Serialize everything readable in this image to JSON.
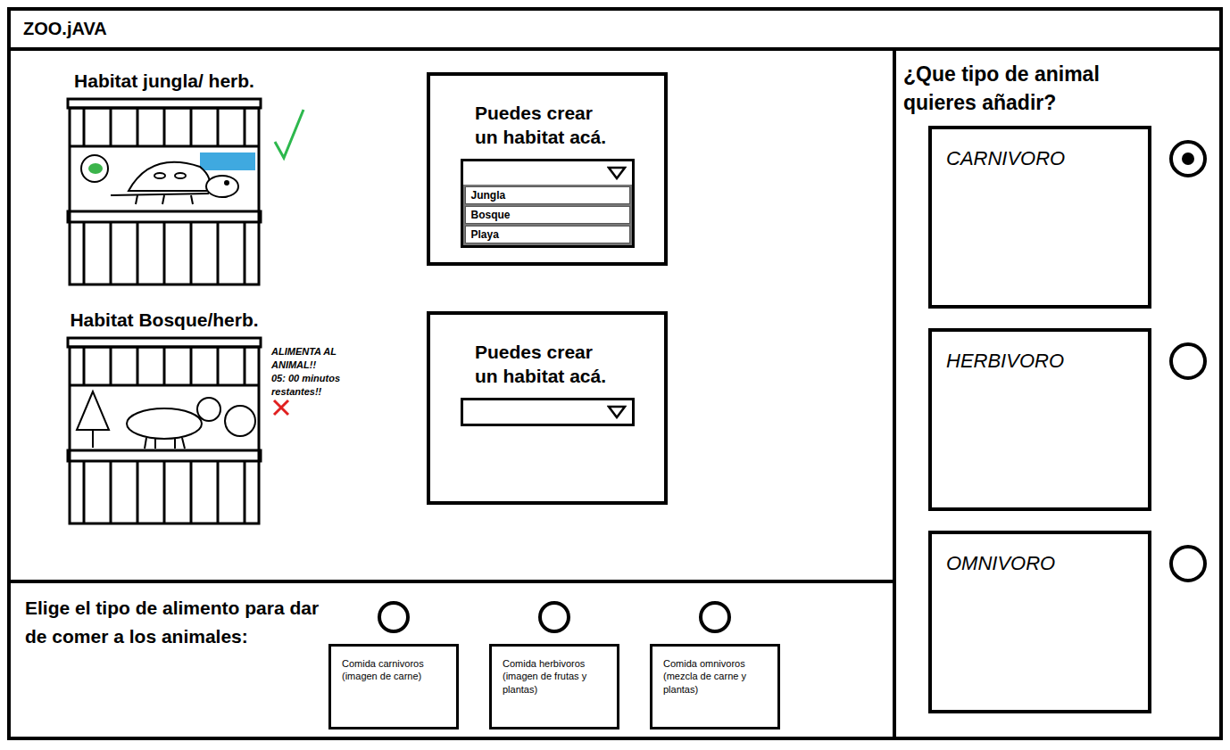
{
  "window": {
    "title": "ZOO.jAVA"
  },
  "habitats": [
    {
      "title": "Habitat jungla/ herb.",
      "kind": "jungle",
      "fed": true,
      "message": "",
      "timer": ""
    },
    {
      "title": "Habitat Bosque/herb.",
      "kind": "forest",
      "fed": false,
      "message": "ALIMENTA AL ANIMAL!!",
      "timer": "05: 00 minutos restantes!!"
    }
  ],
  "creators": [
    {
      "lines": [
        "Puedes crear",
        "un habitat acá."
      ],
      "dropdown": {
        "open": true,
        "value": "",
        "options": [
          "Jungla",
          "Bosque",
          "Playa"
        ]
      }
    },
    {
      "lines": [
        "Puedes crear",
        "un habitat acá."
      ],
      "dropdown": {
        "open": false,
        "value": "",
        "options": []
      }
    }
  ],
  "animal_panel": {
    "title": "¿Que tipo de animal quieres añadir?",
    "options": [
      {
        "label": "CARNIVORO",
        "selected": true
      },
      {
        "label": "HERBIVORO",
        "selected": false
      },
      {
        "label": "OMNIVORO",
        "selected": false
      }
    ]
  },
  "food_panel": {
    "title": "Elige el tipo de alimento para dar de comer a los animales:",
    "options": [
      {
        "label": "Comida carnivoros (imagen de carne)",
        "selected": false
      },
      {
        "label": "Comida herbivoros (imagen de frutas y plantas)",
        "selected": false
      },
      {
        "label": "Comida omnivoros (mezcla de carne y plantas)",
        "selected": false
      }
    ]
  }
}
